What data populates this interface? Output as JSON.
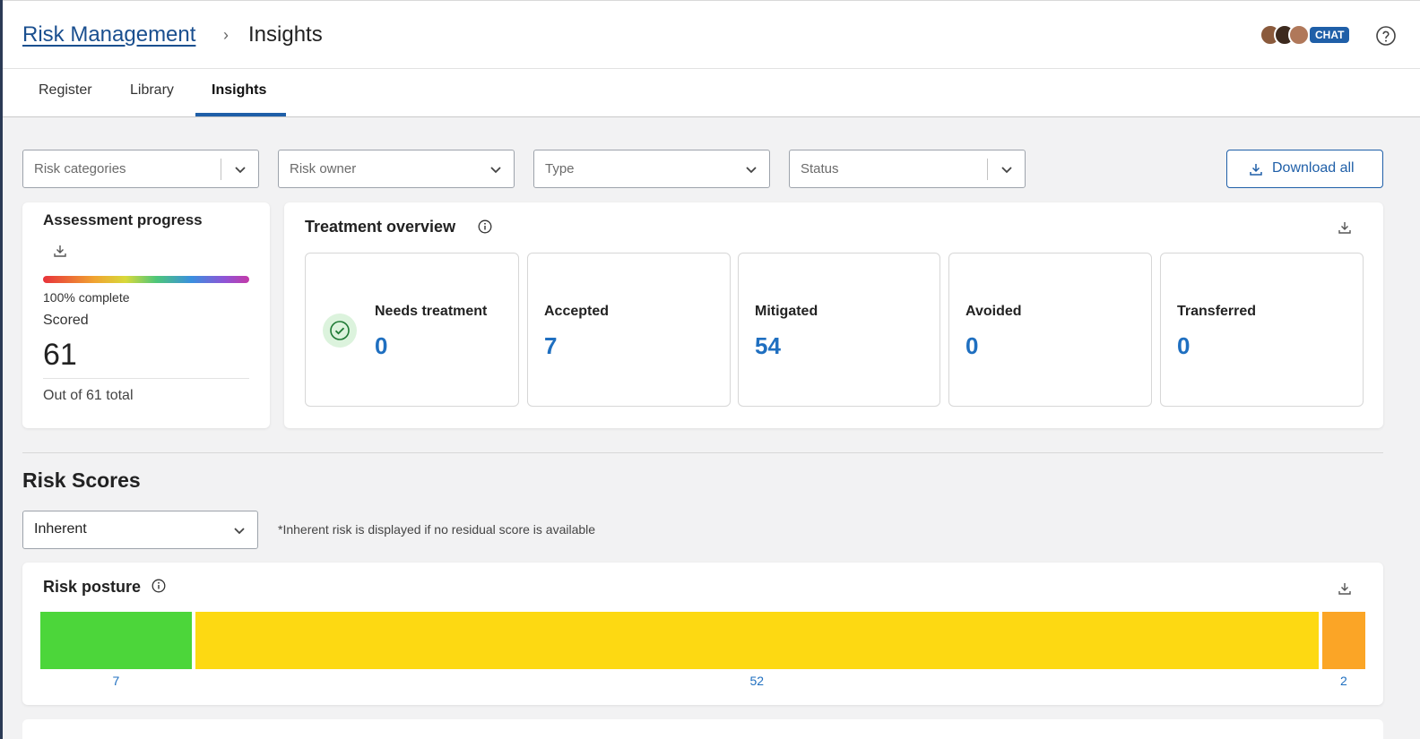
{
  "breadcrumb": {
    "root": "Risk Management",
    "separator": "›",
    "current": "Insights"
  },
  "header": {
    "chat_label": "CHAT",
    "help_icon": "question-circle-icon"
  },
  "tabs": [
    {
      "label": "Register",
      "active": false
    },
    {
      "label": "Library",
      "active": false
    },
    {
      "label": "Insights",
      "active": true
    }
  ],
  "filters": {
    "risk_categories": "Risk categories",
    "risk_owner": "Risk owner",
    "type": "Type",
    "status": "Status",
    "download_all": "Download all"
  },
  "assessment_progress": {
    "title": "Assessment progress",
    "progress_percent": 100,
    "complete_label": "100% complete",
    "scored_label": "Scored",
    "scored_value": "61",
    "total_label": "Out of 61 total"
  },
  "treatment_overview": {
    "title": "Treatment overview",
    "tiles": [
      {
        "label": "Needs treatment",
        "value": "0",
        "icon": "check-circle-icon"
      },
      {
        "label": "Accepted",
        "value": "7"
      },
      {
        "label": "Mitigated",
        "value": "54"
      },
      {
        "label": "Avoided",
        "value": "0"
      },
      {
        "label": "Transferred",
        "value": "0"
      }
    ]
  },
  "risk_scores": {
    "title": "Risk Scores",
    "score_type": "Inherent",
    "note": "*Inherent risk is displayed if no residual score is available"
  },
  "risk_posture": {
    "title": "Risk posture",
    "segments": [
      {
        "value": 7,
        "label": "7",
        "color": "#4cd63a"
      },
      {
        "value": 52,
        "label": "52",
        "color": "#fdd912"
      },
      {
        "value": 2,
        "label": "2",
        "color": "#fba526"
      }
    ]
  }
}
